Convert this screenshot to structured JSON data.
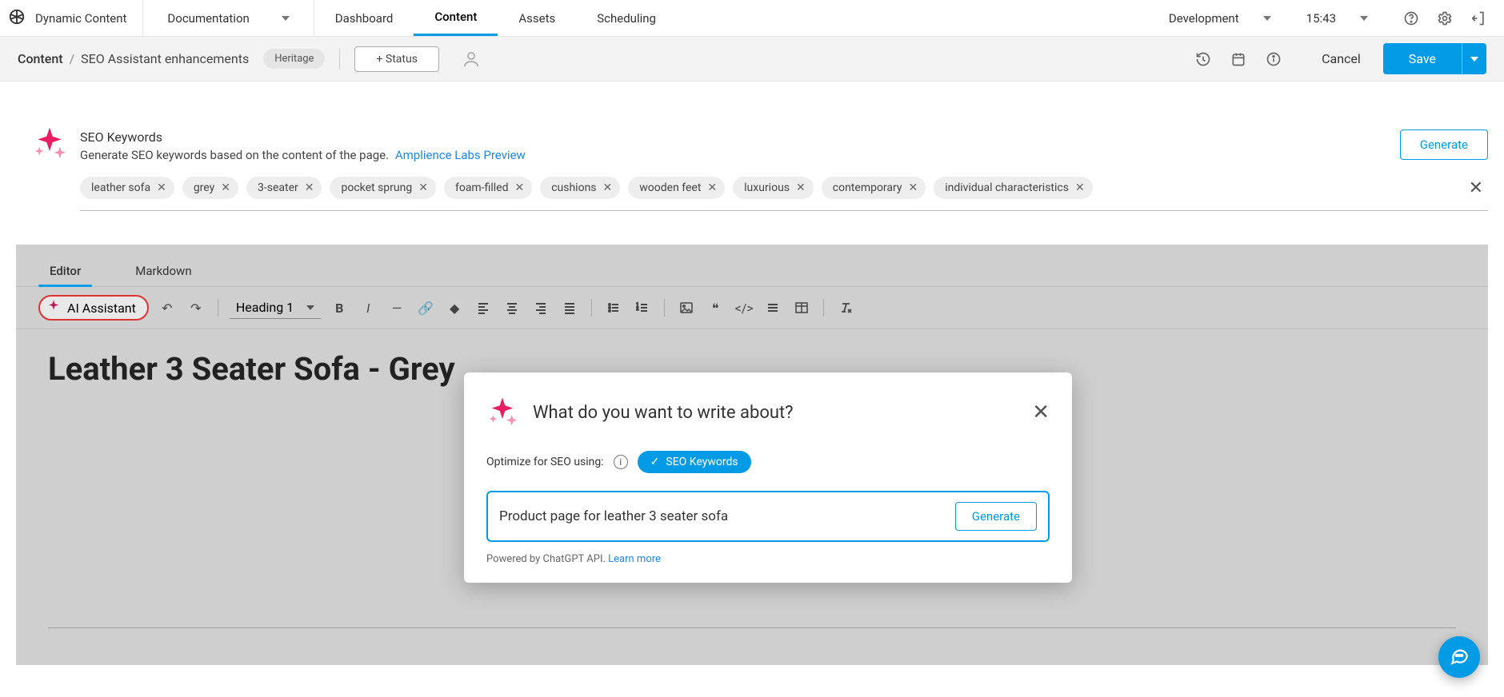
{
  "brand": {
    "name": "Dynamic Content"
  },
  "top_nav": {
    "documentation_label": "Documentation",
    "tabs": [
      {
        "label": "Dashboard"
      },
      {
        "label": "Content"
      },
      {
        "label": "Assets"
      },
      {
        "label": "Scheduling"
      }
    ],
    "env_label": "Development",
    "time": "15:43"
  },
  "subheader": {
    "crumb_root": "Content",
    "crumb_leaf": "SEO Assistant enhancements",
    "type_chip": "Heritage",
    "status_button": "+ Status",
    "cancel": "Cancel",
    "save": "Save"
  },
  "seo_block": {
    "title": "SEO Keywords",
    "subtitle_prefix": "Generate SEO keywords based on the content of the page.",
    "subtitle_link": "Amplience Labs Preview",
    "generate": "Generate",
    "tags": [
      "leather sofa",
      "grey",
      "3-seater",
      "pocket sprung",
      "foam-filled",
      "cushions",
      "wooden feet",
      "luxurious",
      "contemporary",
      "individual characteristics"
    ]
  },
  "editor": {
    "tabs": {
      "editor": "Editor",
      "markdown": "Markdown"
    },
    "ai_assistant_label": "AI Assistant",
    "heading_selector": "Heading 1",
    "doc_h1": "Leather 3 Seater Sofa - Grey"
  },
  "ai_modal": {
    "title": "What do you want to write about?",
    "optimize_label": "Optimize for SEO using:",
    "seo_chip": "SEO Keywords",
    "input_value": "Product page for leather 3 seater sofa",
    "generate": "Generate",
    "footer_prefix": "Powered by ChatGPT API.",
    "footer_link": "Learn more"
  },
  "icons": {
    "help": "help-icon",
    "settings": "gear-icon",
    "logout": "logout-icon",
    "history": "history-icon",
    "calendar": "calendar-icon",
    "info": "info-icon",
    "chat": "chat-icon"
  }
}
